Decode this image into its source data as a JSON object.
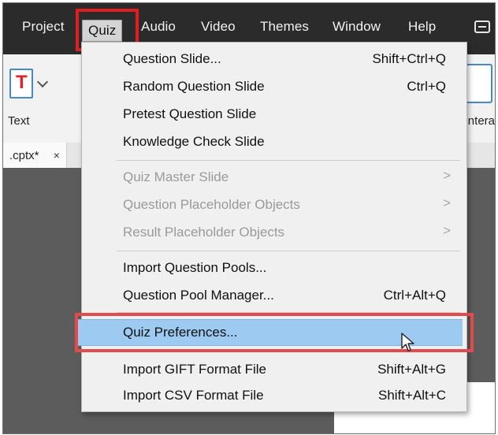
{
  "menubar": {
    "items": [
      "Project",
      "Quiz",
      "Audio",
      "Video",
      "Themes",
      "Window",
      "Help"
    ],
    "active": "Quiz"
  },
  "ribbon": {
    "left_label": "Text",
    "right_label": "Intera"
  },
  "tab": {
    "filename": ".cptx*",
    "close": "×"
  },
  "dropdown": {
    "items": [
      {
        "label": "Question Slide...",
        "shortcut": "Shift+Ctrl+Q",
        "enabled": true
      },
      {
        "label": "Random Question Slide",
        "shortcut": "Ctrl+Q",
        "enabled": true
      },
      {
        "label": "Pretest Question Slide",
        "shortcut": "",
        "enabled": true
      },
      {
        "label": "Knowledge Check Slide",
        "shortcut": "",
        "enabled": true
      },
      {
        "label": "Quiz Master Slide",
        "shortcut": "",
        "enabled": false,
        "submenu": true
      },
      {
        "label": "Question Placeholder Objects",
        "shortcut": "",
        "enabled": false,
        "submenu": true
      },
      {
        "label": "Result Placeholder Objects",
        "shortcut": "",
        "enabled": false,
        "submenu": true
      },
      {
        "label": "Import Question Pools...",
        "shortcut": "",
        "enabled": true
      },
      {
        "label": "Question Pool Manager...",
        "shortcut": "Ctrl+Alt+Q",
        "enabled": true
      },
      {
        "label": "Quiz Preferences...",
        "shortcut": "",
        "enabled": true,
        "selected": true
      },
      {
        "label": "Import GIFT Format File",
        "shortcut": "Shift+Alt+G",
        "enabled": true
      },
      {
        "label": "Import CSV Format File",
        "shortcut": "Shift+Alt+C",
        "enabled": true
      }
    ],
    "submenu_arrow": ">"
  },
  "colors": {
    "menubar_bg": "#2b2b2b",
    "highlight_red": "#e02020",
    "selection_blue": "#9ccaf0"
  },
  "icons": [
    "text-t-icon",
    "chevron-down-icon",
    "chat-icon",
    "submenu-arrow-icon",
    "mouse-pointer-icon"
  ]
}
